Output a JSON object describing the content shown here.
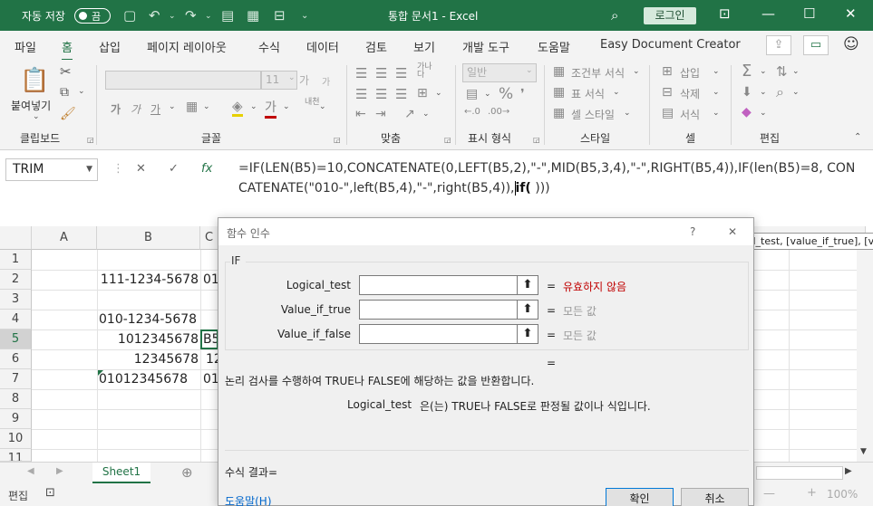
{
  "titlebar": {
    "autosave_label": "자동 저장",
    "autosave_state": "끔",
    "doc_title": "통합 문서1  -  Excel",
    "login_label": "로그인",
    "accent": "#217346"
  },
  "menu": {
    "tabs": [
      "파일",
      "홈",
      "삽입",
      "페이지 레이아웃",
      "수식",
      "데이터",
      "검토",
      "보기",
      "개발 도구",
      "도움말",
      "Easy Document Creator"
    ],
    "active": "홈"
  },
  "ribbon": {
    "clipboard": {
      "paste_label": "붙여넣기",
      "group_label": "클립보드"
    },
    "font": {
      "font_name": "",
      "font_size": "11",
      "group_label": "글꼴",
      "grow": "가",
      "shrink": "가",
      "bold": "가",
      "italic": "가",
      "underline": "가",
      "color_a": "가",
      "phonetic": "내천"
    },
    "alignment": {
      "group_label": "맞춤",
      "wrap": "가나다"
    },
    "number": {
      "format": "일반",
      "group_label": "표시 형식"
    },
    "styles": {
      "conditional": "조건부 서식",
      "table": "표 서식",
      "cell": "셀 스타일",
      "group_label": "스타일"
    },
    "cells": {
      "insert": "삽입",
      "delete": "삭제",
      "format": "서식",
      "group_label": "셀"
    },
    "editing": {
      "group_label": "편집"
    }
  },
  "formula_bar": {
    "name_box": "TRIM",
    "fx": "fx",
    "formula_main": "=IF(LEN(B5)=10,CONCATENATE(0,LEFT(B5,2),\"-\",MID(B5,3,4),\"-\",RIGHT(B5,4)),IF(len(B5)=8, CONCATENATE(\"010-\",left(B5,4),\"-\",right(B5,4)),",
    "formula_bold": "if(",
    "formula_end": " )))"
  },
  "grid": {
    "columns": [
      "A",
      "B",
      "C"
    ],
    "rows": [
      "1",
      "2",
      "3",
      "4",
      "5",
      "6",
      "7",
      "8",
      "9",
      "10",
      "11"
    ],
    "cells": {
      "b2": "111-1234-5678",
      "c2": "01",
      "b4": "010-1234-5678",
      "b5": "1012345678",
      "c5": "B5",
      "b6": "12345678",
      "c6": "12",
      "b7": "01012345678",
      "c7": "01"
    }
  },
  "dialog": {
    "title": "함수 인수",
    "help_glyph": "?",
    "close_glyph": "✕",
    "function_name": "IF",
    "args": [
      {
        "label": "Logical_test",
        "value": "",
        "result": "유효하지 않음",
        "result_color": "#c00000"
      },
      {
        "label": "Value_if_true",
        "value": "",
        "result": "모든 값",
        "result_color": "#999999"
      },
      {
        "label": "Value_if_false",
        "value": "",
        "result": "모든 값",
        "result_color": "#999999"
      }
    ],
    "equals": "=",
    "description": "논리 검사를 수행하여 TRUE나 FALSE에 해당하는 값을 반환합니다.",
    "arg_help_name": "Logical_test",
    "arg_help_text": "은(는) TRUE나 FALSE로 판정될 값이나 식입니다.",
    "result_label": "수식 결과=",
    "help_link": "도움말(H)",
    "ok_label": "확인",
    "cancel_label": "취소"
  },
  "tooltip": "IF(logical_test, [value_if_true], [value_if_false])",
  "sheets": {
    "active": "Sheet1"
  },
  "status": {
    "mode": "편집",
    "zoom": "100%"
  }
}
